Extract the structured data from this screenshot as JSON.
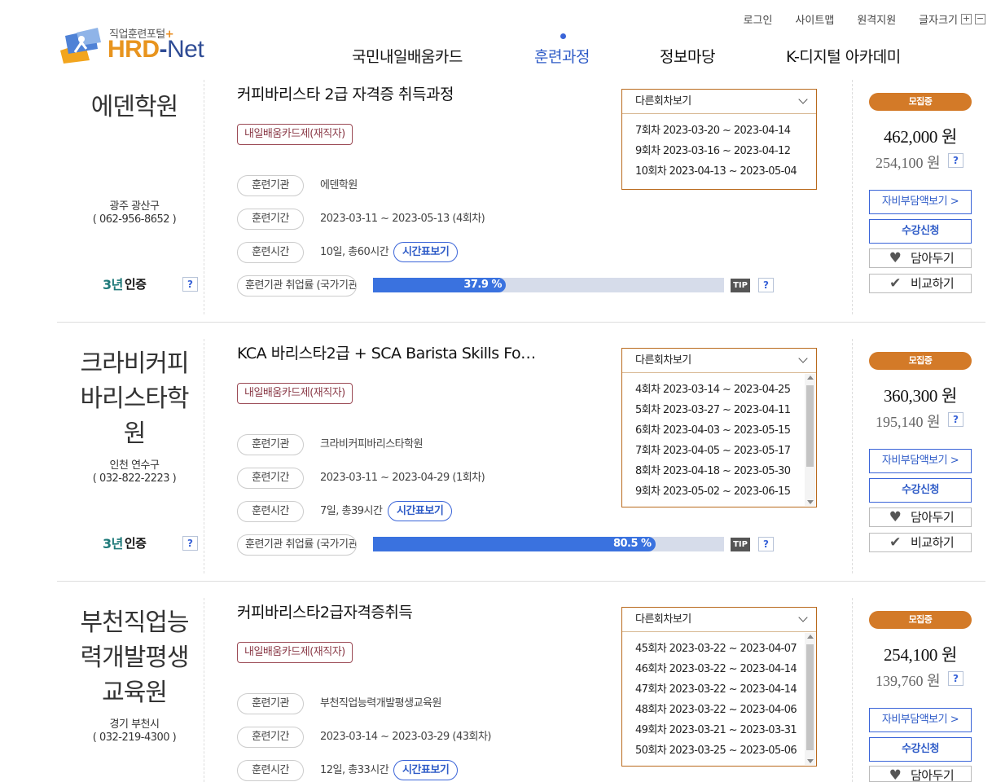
{
  "header": {
    "logo_sub": "직업훈련포털",
    "logo_plus": "+",
    "logo_hrd": "HRD",
    "logo_dash": "-",
    "logo_net": "Net",
    "util": [
      "로그인",
      "사이트맵",
      "원격지원",
      "글자크기"
    ],
    "fs_plus": "+",
    "fs_minus": "−",
    "nav": [
      "국민내일배움카드",
      "훈련과정",
      "정보마당",
      "K-디지털 아카데미"
    ],
    "active_nav": "훈련과정"
  },
  "labels": {
    "rounds_toggle": "다른회차보기",
    "org": "훈련기관",
    "period": "훈련기간",
    "hours": "훈련시간",
    "employment": "훈련기관 취업률 (국가기관)",
    "timetable": "시간표보기",
    "tip": "TIP",
    "question": "?",
    "status": "모집중",
    "subsidy": "자비부담액보기 >",
    "apply": "수강신청",
    "wish": "담아두기",
    "compare": "비교하기",
    "cert_year": "3년",
    "cert_text": "인증"
  },
  "courses": [
    {
      "inst_name_lines": [
        "에덴학원"
      ],
      "location": "광주 광산구",
      "phone": "( 062-956-8652 )",
      "title": "커피바리스타 2급 자격증 취득과정",
      "tag": "내일배움카드제(재직자)",
      "org": "에덴학원",
      "period": "2023-03-11 ~ 2023-05-13 (4회차)",
      "hours": "10일, 총60시간",
      "employment_rate_text": "37.9 %",
      "employment_rate": 37.9,
      "rounds": [
        "7회차 2023-03-20 ~ 2023-04-14",
        "9회차 2023-03-16 ~ 2023-04-12",
        "10회차 2023-04-13 ~ 2023-05-04"
      ],
      "price": "462,000 원",
      "price_self": "254,100 원"
    },
    {
      "inst_name_lines": [
        "크라비커피",
        "바리스타학",
        "원"
      ],
      "location": "인천 연수구",
      "phone": "( 032-822-2223 )",
      "title": "KCA 바리스타2급 + SCA Barista Skills Fo…",
      "tag": "내일배움카드제(재직자)",
      "org": "크라비커피바리스타학원",
      "period": "2023-03-11 ~ 2023-04-29 (1회차)",
      "hours": "7일, 총39시간",
      "employment_rate_text": "80.5 %",
      "employment_rate": 80.5,
      "rounds": [
        "4회차 2023-03-14 ~ 2023-04-25",
        "5회차 2023-03-27 ~ 2023-04-11",
        "6회차 2023-04-03 ~ 2023-05-15",
        "7회차 2023-04-05 ~ 2023-05-17",
        "8회차 2023-04-18 ~ 2023-05-30",
        "9회차 2023-05-02 ~ 2023-06-15"
      ],
      "price": "360,300 원",
      "price_self": "195,140 원"
    },
    {
      "inst_name_lines": [
        "부천직업능",
        "력개발평생",
        "교육원"
      ],
      "location": "경기 부천시",
      "phone": "( 032-219-4300 )",
      "title": "커피바리스타2급자격증취득",
      "tag": "내일배움카드제(재직자)",
      "org": "부천직업능력개발평생교육원",
      "period": "2023-03-14 ~ 2023-03-29 (43회차)",
      "hours": "12일, 총33시간",
      "rounds": [
        "45회차 2023-03-22 ~ 2023-04-07",
        "46회차 2023-03-22 ~ 2023-04-14",
        "47회차 2023-03-22 ~ 2023-04-14",
        "48회차 2023-03-22 ~ 2023-04-06",
        "49회차 2023-03-21 ~ 2023-03-31",
        "50회차 2023-03-25 ~ 2023-05-06"
      ],
      "price": "254,100 원",
      "price_self": "139,760 원"
    }
  ]
}
